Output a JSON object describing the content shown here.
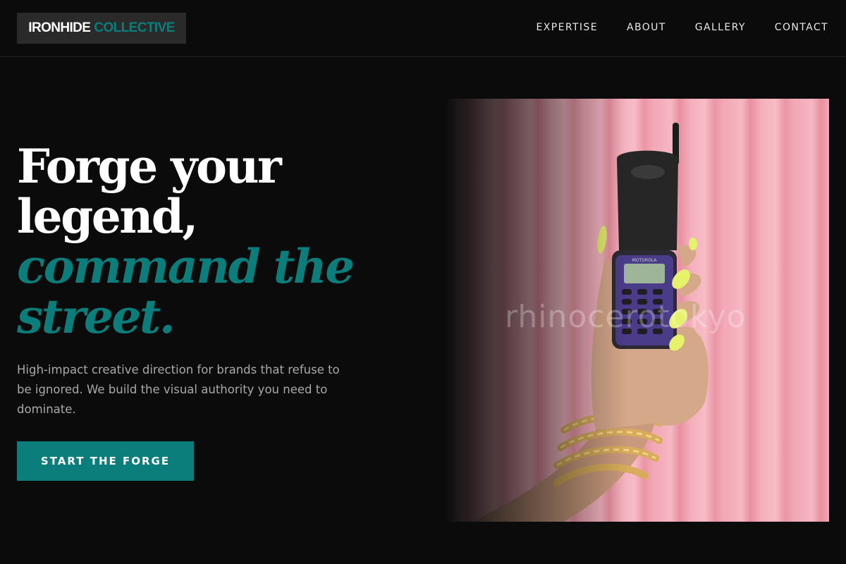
{
  "header": {
    "logo": {
      "word1": "IRONHIDE",
      "word2": "COLLECTIVE"
    },
    "nav": [
      {
        "label": "EXPERTISE"
      },
      {
        "label": "ABOUT"
      },
      {
        "label": "GALLERY"
      },
      {
        "label": "CONTACT"
      }
    ]
  },
  "hero": {
    "headline": {
      "line1": "Forge your",
      "line2": "legend,",
      "accent1": "command the",
      "accent2": "street."
    },
    "subtext": "High-impact creative direction for brands that refuse to be ignored. We build the visual authority you need to dominate.",
    "cta_label": "START THE FORGE",
    "image": {
      "watermark": "rhinocerotokyo",
      "phone_brand": "MOTOROLA"
    }
  },
  "colors": {
    "background": "#0b0b0b",
    "accent": "#0b7e7c",
    "logo_bg": "#2a2a2a",
    "curtain": "#f2a9b6"
  }
}
